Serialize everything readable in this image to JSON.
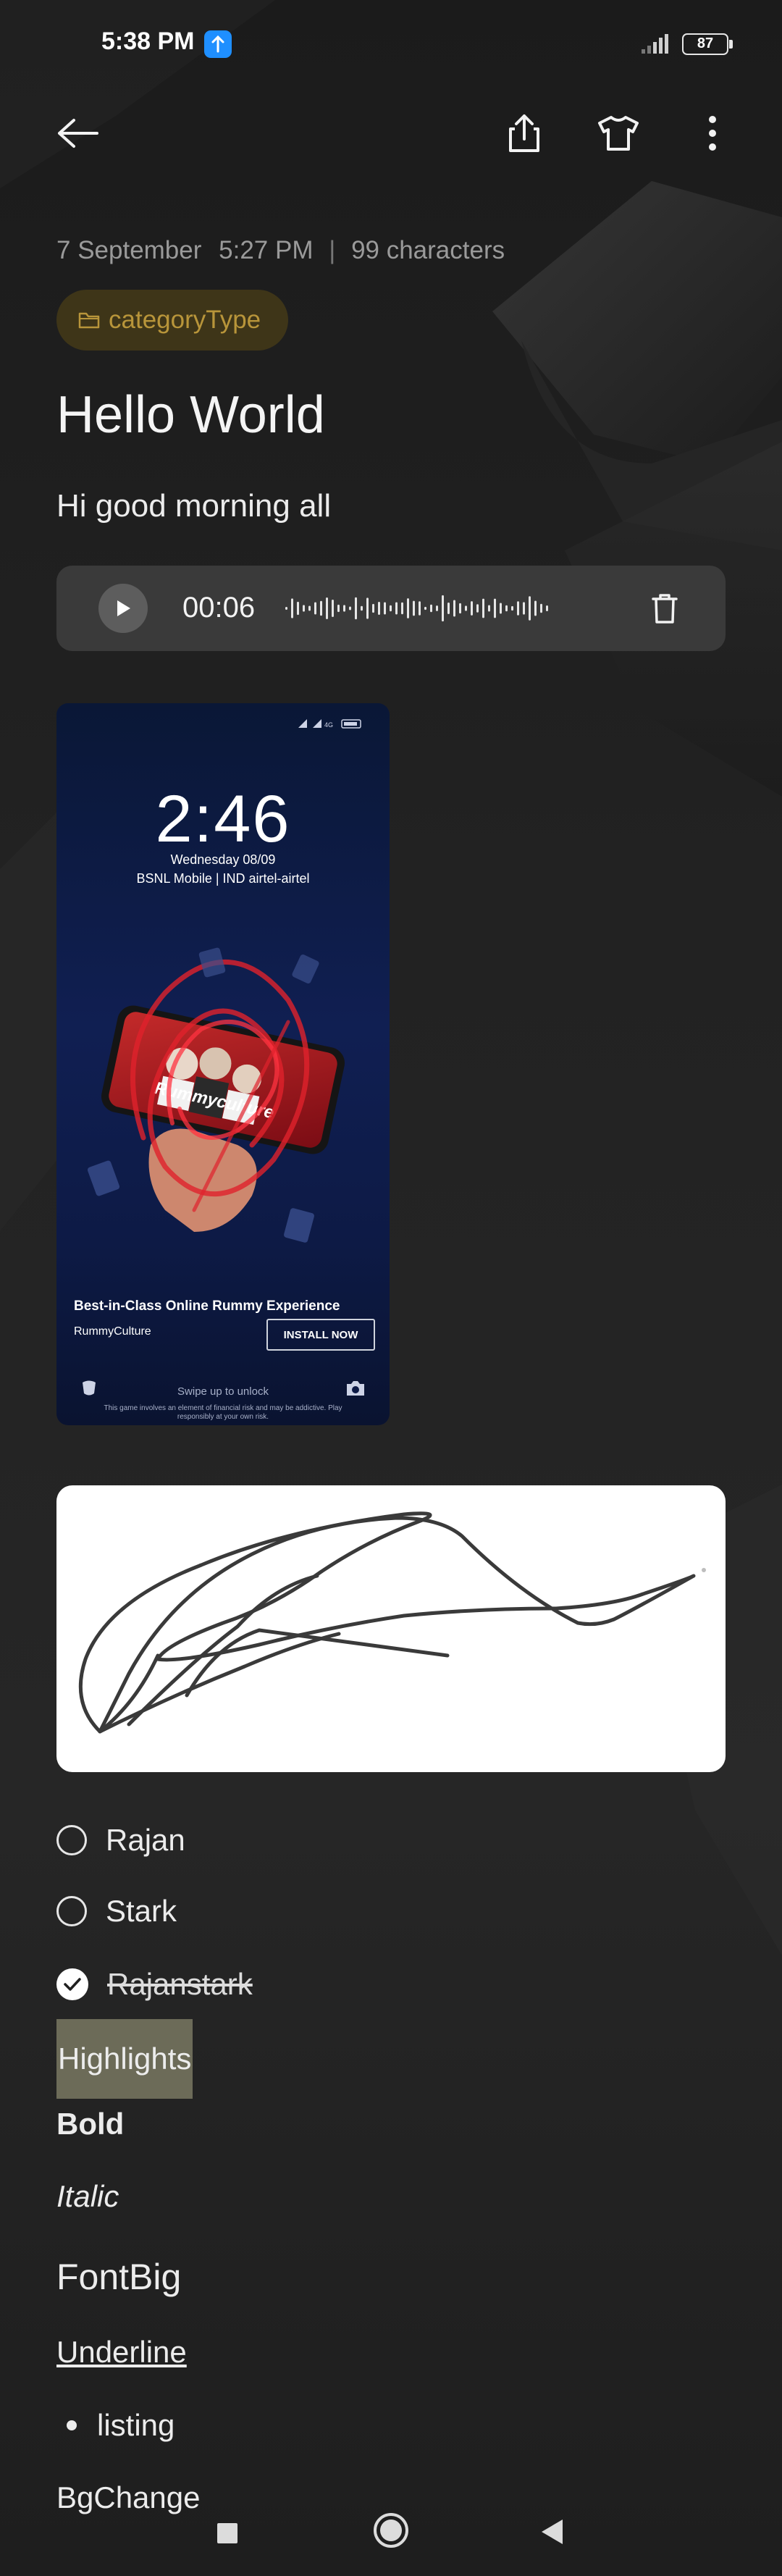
{
  "status_bar": {
    "time": "5:38 PM",
    "battery": "87",
    "icons": [
      "upload-notification-icon",
      "signal-icon",
      "battery-icon"
    ]
  },
  "toolbar": {
    "icons": [
      "back-arrow-icon",
      "share-icon",
      "theme-shirt-icon",
      "more-vertical-icon"
    ]
  },
  "note": {
    "date": "7 September",
    "time": "5:27 PM",
    "separator": "|",
    "characters": "99 characters",
    "category": "categoryType",
    "title": "Hello World",
    "body": "Hi good morning all"
  },
  "audio": {
    "duration": "00:06",
    "icons": [
      "play-icon",
      "waveform-icon",
      "trash-icon"
    ]
  },
  "screenshot": {
    "clock": "2:46",
    "date": "Wednesday 08/09",
    "carrier": "BSNL Mobile | IND airtel-airtel",
    "ad_title": "Best-in-Class Online Rummy Experience",
    "brand": "RummyCulture",
    "install_label": "INSTALL NOW",
    "swipe_text": "Swipe up to unlock",
    "disclaimer": "This game involves an element of financial risk and may be addictive. Play responsibly at your own risk.",
    "banner_text": "Rummyculture"
  },
  "checklist": [
    {
      "label": "Rajan",
      "checked": false
    },
    {
      "label": "Stark",
      "checked": false
    },
    {
      "label": "Rajanstark",
      "checked": true
    }
  ],
  "formatting": {
    "highlight": "Highlights",
    "bold": "Bold",
    "italic": "Italic",
    "big": "FontBig",
    "underline": "Underline",
    "list_item": "listing",
    "bg_change": "BgChange"
  },
  "nav_bar": {
    "icons": [
      "recents-square-icon",
      "home-circle-icon",
      "back-triangle-icon"
    ]
  },
  "colors": {
    "background": "#1f1f1f",
    "card": "#3a3a3a",
    "category_text": "#b8953a",
    "category_chip": "#3e3518",
    "highlight": "#6c6b58"
  }
}
